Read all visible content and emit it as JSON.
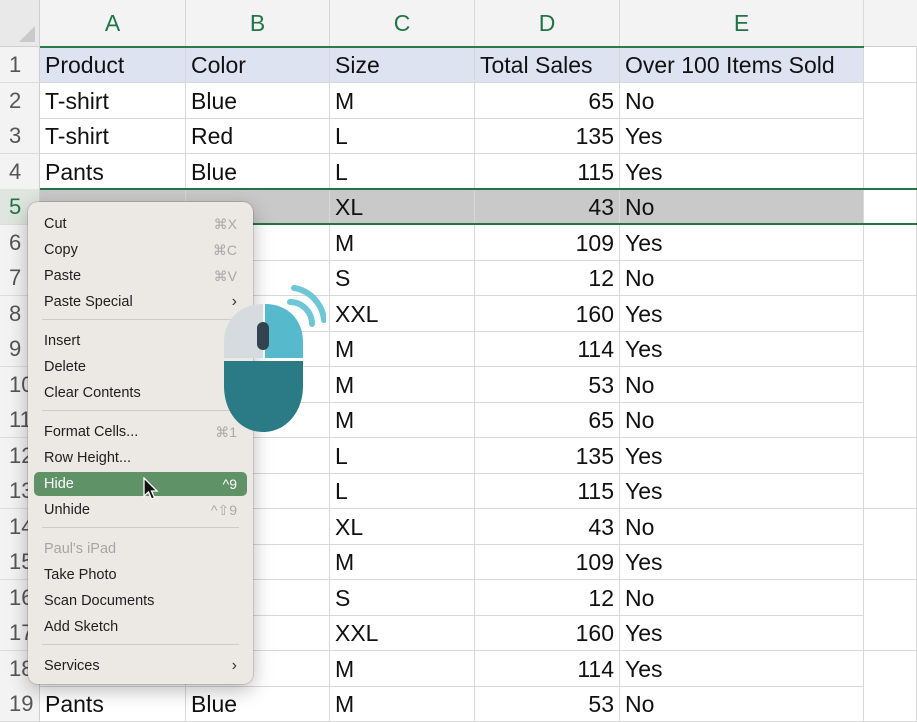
{
  "columns": [
    "A",
    "B",
    "C",
    "D",
    "E"
  ],
  "header_row": {
    "num": "1",
    "cells": [
      "Product",
      "Color",
      "Size",
      "Total Sales",
      "Over 100 Items Sold"
    ]
  },
  "rows": [
    {
      "num": "2",
      "a": "T-shirt",
      "b": "Blue",
      "c": "M",
      "d": "65",
      "e": "No"
    },
    {
      "num": "3",
      "a": "T-shirt",
      "b": "Red",
      "c": "L",
      "d": "135",
      "e": "Yes"
    },
    {
      "num": "4",
      "a": "Pants",
      "b": "Blue",
      "c": "L",
      "d": "115",
      "e": "Yes"
    },
    {
      "num": "5",
      "a": "",
      "b": "",
      "c": "XL",
      "d": "43",
      "e": "No"
    },
    {
      "num": "6",
      "a": "",
      "b": "",
      "c": "M",
      "d": "109",
      "e": "Yes"
    },
    {
      "num": "7",
      "a": "",
      "b": "",
      "c": "S",
      "d": "12",
      "e": "No"
    },
    {
      "num": "8",
      "a": "",
      "b": "",
      "c": "XXL",
      "d": "160",
      "e": "Yes"
    },
    {
      "num": "9",
      "a": "",
      "b": "",
      "c": "M",
      "d": "114",
      "e": "Yes"
    },
    {
      "num": "10",
      "a": "",
      "b": "",
      "c": "M",
      "d": "53",
      "e": "No"
    },
    {
      "num": "11",
      "a": "",
      "b": "",
      "c": "M",
      "d": "65",
      "e": "No"
    },
    {
      "num": "12",
      "a": "",
      "b": "",
      "c": "L",
      "d": "135",
      "e": "Yes"
    },
    {
      "num": "13",
      "a": "",
      "b": "",
      "c": "L",
      "d": "115",
      "e": "Yes"
    },
    {
      "num": "14",
      "a": "",
      "b": "",
      "c": "XL",
      "d": "43",
      "e": "No"
    },
    {
      "num": "15",
      "a": "",
      "b": "",
      "c": "M",
      "d": "109",
      "e": "Yes"
    },
    {
      "num": "16",
      "a": "",
      "b": "",
      "c": "S",
      "d": "12",
      "e": "No"
    },
    {
      "num": "17",
      "a": "",
      "b": "",
      "c": "XXL",
      "d": "160",
      "e": "Yes"
    },
    {
      "num": "18",
      "a": "",
      "b": "",
      "c": "M",
      "d": "114",
      "e": "Yes"
    },
    {
      "num": "19",
      "a": "Pants",
      "b": "Blue",
      "c": "M",
      "d": "53",
      "e": "No"
    }
  ],
  "context_menu": {
    "cut": {
      "label": "Cut",
      "shortcut": "⌘X"
    },
    "copy": {
      "label": "Copy",
      "shortcut": "⌘C"
    },
    "paste": {
      "label": "Paste",
      "shortcut": "⌘V"
    },
    "paste_special": {
      "label": "Paste Special",
      "arrow": "›"
    },
    "insert": {
      "label": "Insert"
    },
    "delete": {
      "label": "Delete"
    },
    "clear_contents": {
      "label": "Clear Contents"
    },
    "format_cells": {
      "label": "Format Cells...",
      "shortcut": "⌘1"
    },
    "row_height": {
      "label": "Row Height..."
    },
    "hide": {
      "label": "Hide",
      "shortcut": "^9"
    },
    "unhide": {
      "label": "Unhide",
      "shortcut": "^⇧9"
    },
    "device_name": {
      "label": "Paul's iPad"
    },
    "take_photo": {
      "label": "Take Photo"
    },
    "scan_documents": {
      "label": "Scan Documents"
    },
    "add_sketch": {
      "label": "Add Sketch"
    },
    "services": {
      "label": "Services",
      "arrow": "›"
    }
  },
  "colors": {
    "accent_green": "#227447",
    "header_fill": "#dde3f0",
    "selected_row_fill": "#c9c9c9",
    "menu_highlight": "#5f9367",
    "mouse_icon_teal": "#2b7b86"
  }
}
